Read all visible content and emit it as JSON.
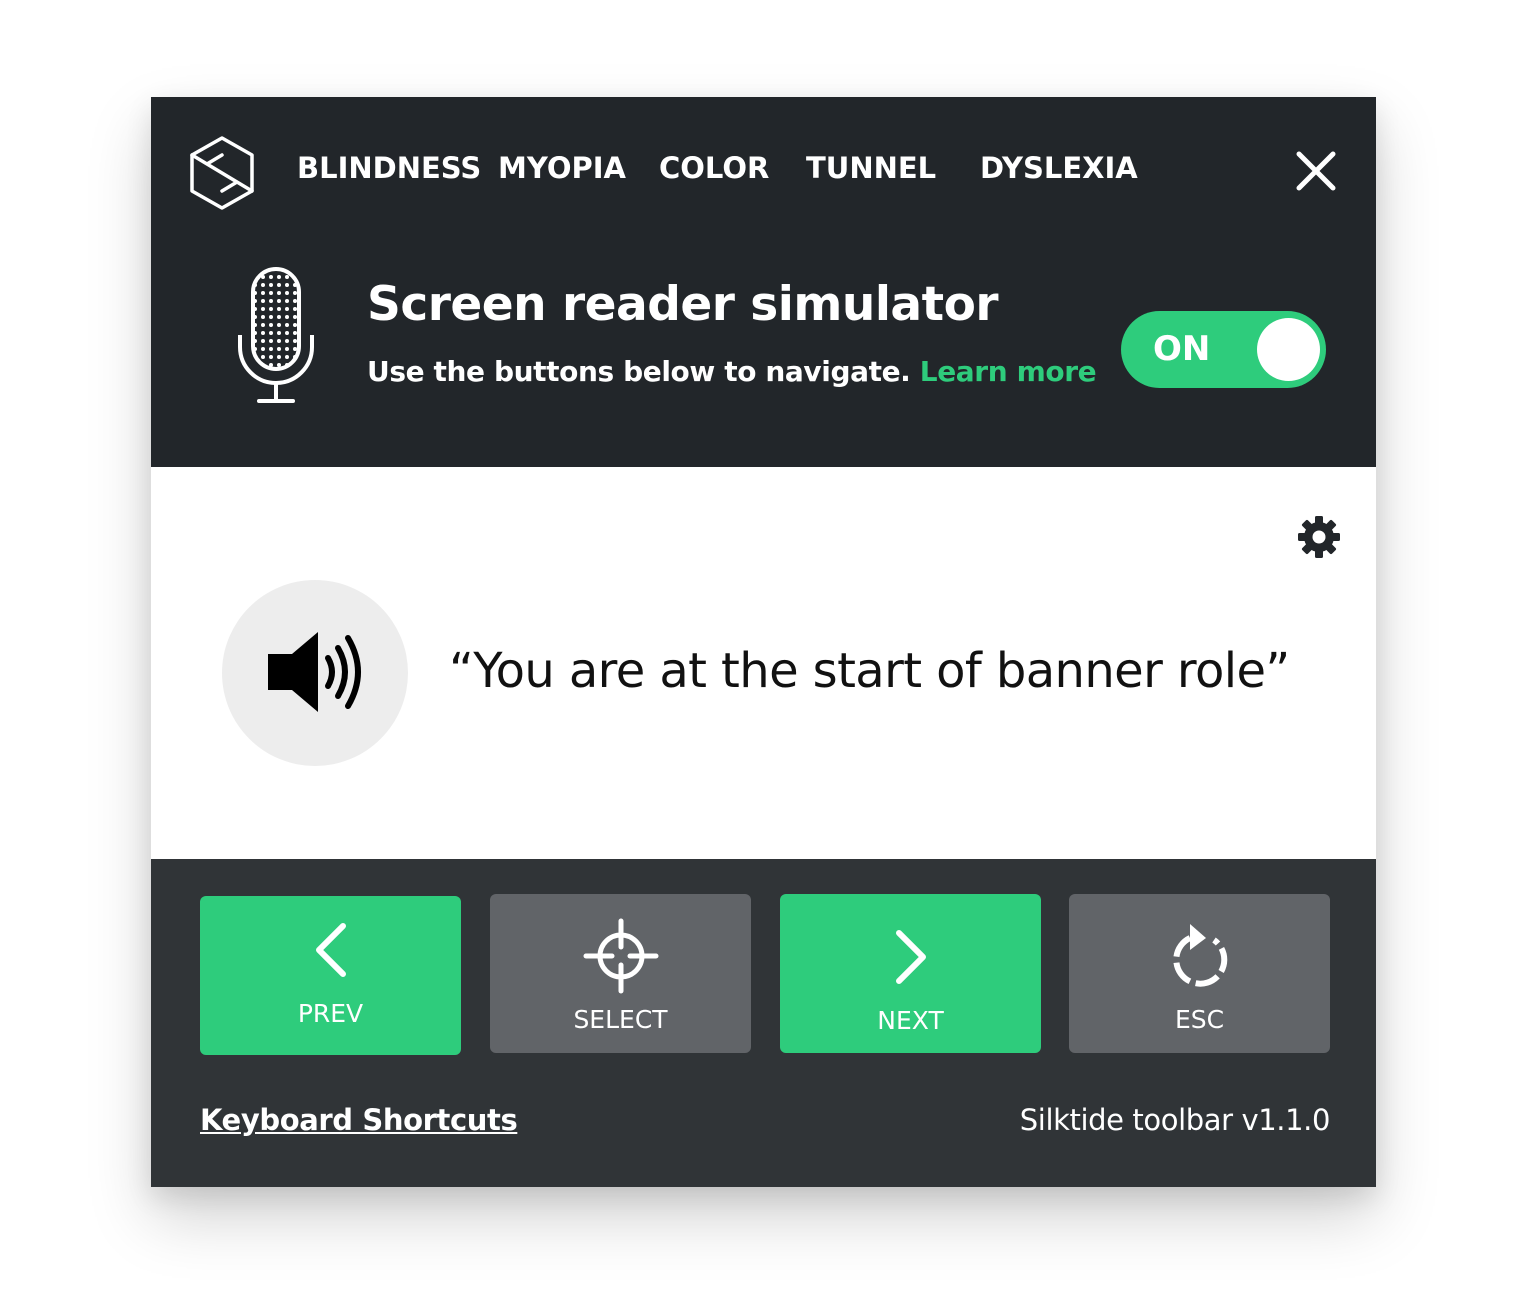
{
  "nav": {
    "items": [
      {
        "label": "BLINDNESS"
      },
      {
        "label": "MYOPIA"
      },
      {
        "label": "COLOR"
      },
      {
        "label": "TUNNEL"
      },
      {
        "label": "DYSLEXIA"
      }
    ]
  },
  "simulator": {
    "title": "Screen reader simulator",
    "description": "Use the buttons below to navigate.",
    "learn_more": "Learn more",
    "toggle_label": "ON"
  },
  "speech": {
    "text": "“You are at the start of banner role”"
  },
  "controls": {
    "prev": "PREV",
    "select": "SELECT",
    "next": "NEXT",
    "esc": "ESC"
  },
  "footer": {
    "shortcuts": "Keyboard Shortcuts",
    "version": "Silktide toolbar v1.1.0"
  },
  "colors": {
    "accent": "#2ecc7c",
    "header_bg": "#22262a",
    "footer_bg": "#303437",
    "button_grey": "#616468"
  },
  "icons": [
    "silktide-logo-icon",
    "close-icon",
    "microphone-icon",
    "gear-icon",
    "speaker-icon",
    "chevron-left-icon",
    "crosshair-icon",
    "chevron-right-icon",
    "refresh-icon"
  ]
}
